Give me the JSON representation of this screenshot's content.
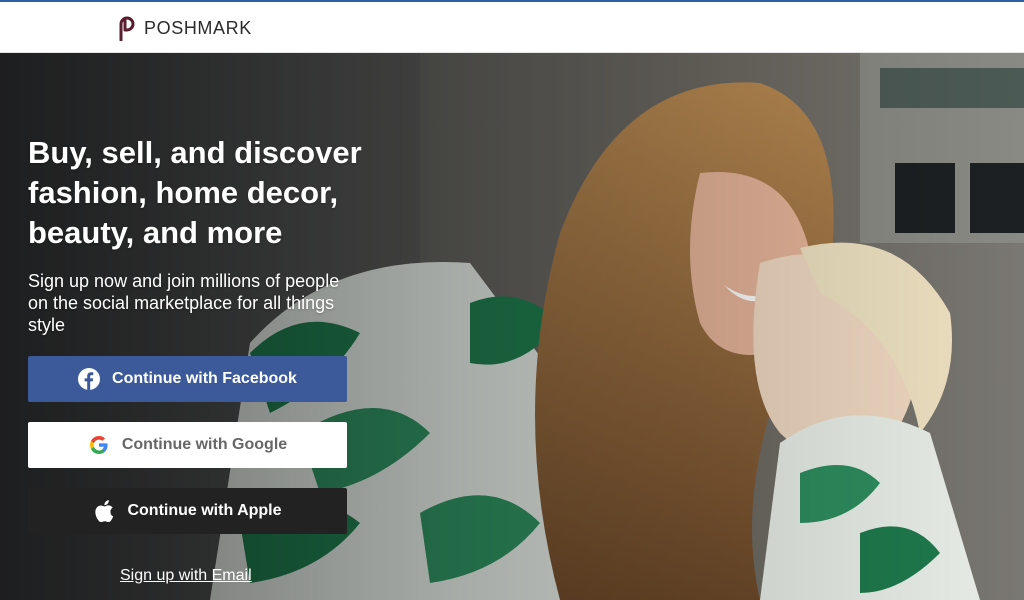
{
  "brand": {
    "name": "POSHMARK",
    "color": "#5a1e2e",
    "topline_color": "#2f5fa7"
  },
  "hero": {
    "headline": "Buy, sell, and discover fashion, home decor, beauty, and more",
    "subtext": "Sign up now and join millions of people on the social marketplace for all things style"
  },
  "auth": {
    "facebook": {
      "label": "Continue with Facebook",
      "icon": "facebook-icon",
      "color": "#3c5a99"
    },
    "google": {
      "label": "Continue with Google",
      "icon": "google-icon"
    },
    "apple": {
      "label": "Continue with Apple",
      "icon": "apple-icon",
      "color": "#222222"
    },
    "email_link": "Sign up with Email"
  }
}
